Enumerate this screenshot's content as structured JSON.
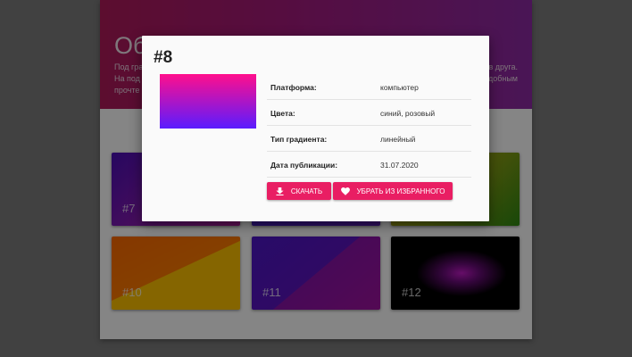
{
  "background": {
    "hero": {
      "title": "Об",
      "text_line1_left": "Под гра",
      "text_line1_right": "в друга.",
      "text_line2_left": "На под",
      "text_line2_right": "добным",
      "text_line3_left": "прочте"
    },
    "cards": [
      {
        "label": "#7",
        "gradient": "linear-gradient(135deg,#4a0fb8 0%,#8a1ab0 50%,#b31b9c 100%)"
      },
      {
        "label": "",
        "gradient": "linear-gradient(135deg,#3c1fc8 0%,#5b1db4 100%)"
      },
      {
        "label": "",
        "gradient": "linear-gradient(135deg,#caa81a 0%,#7d9a14 60%,#2f8a12 100%)"
      },
      {
        "label": "#10",
        "gradient": "linear-gradient(155deg,#ff6a00 0%,#ff7a00 48%,#ffc200 48.5%,#ffc200 100%)"
      },
      {
        "label": "#11",
        "gradient": "linear-gradient(140deg,#4d16c8 0%,#5a15c0 50%,#8a13a8 50.5%,#a012a0 100%)"
      },
      {
        "label": "#12",
        "gradient": "radial-gradient(ellipse at 55% 50%,#c41ac9 0%,#6a0c7a 18%,#000 45%)"
      }
    ]
  },
  "modal": {
    "title": "#8",
    "preview_gradient": [
      "#ff0f8c",
      "#5a1cff"
    ],
    "details": [
      {
        "key": "Платформа:",
        "value": "компьютер"
      },
      {
        "key": "Цвета:",
        "value": "синий, розовый"
      },
      {
        "key": "Тип градиента:",
        "value": "линейный"
      },
      {
        "key": "Дата публикации:",
        "value": "31.07.2020"
      }
    ],
    "download_button": {
      "label": "Скачать",
      "icon": "download-icon"
    },
    "favorite_button": {
      "label": "Убрать из избранного",
      "icon": "heart-icon"
    }
  },
  "colors": {
    "accent": "#e91e63",
    "overlay": "rgba(0,0,0,0.48)"
  }
}
